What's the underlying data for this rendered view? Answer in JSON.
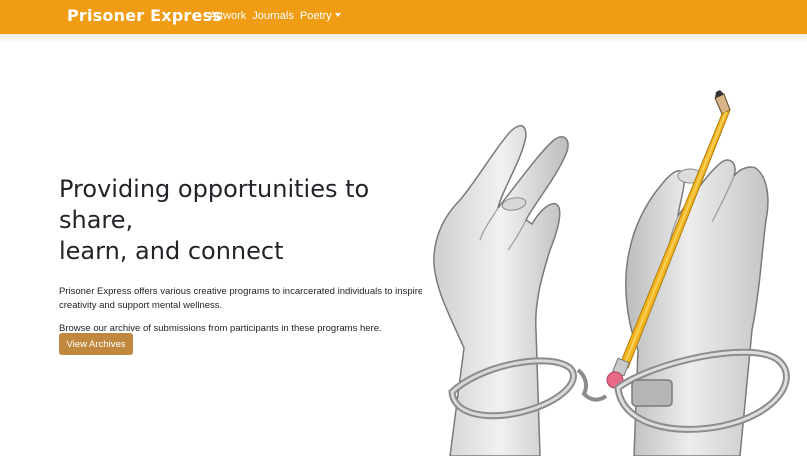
{
  "navbar": {
    "brand": "Prisoner Express",
    "links": [
      {
        "label": "Artwork"
      },
      {
        "label": "Journals"
      },
      {
        "label": "Poetry"
      }
    ],
    "color": "#f09c14"
  },
  "hero": {
    "title": "Providing opportunities to share, learn, and connect",
    "paragraph1_line1": "Prisoner Express offers various creative programs to incarcerated individuals to inspire",
    "paragraph1_line2": "creativity and support mental wellness.",
    "paragraph2": "Browse our archive of submissions from participants in these programs here.",
    "button_label": "View Archives",
    "button_color": "#c0883f",
    "image_icon": "hands-pencil-handcuffs-drawing"
  }
}
